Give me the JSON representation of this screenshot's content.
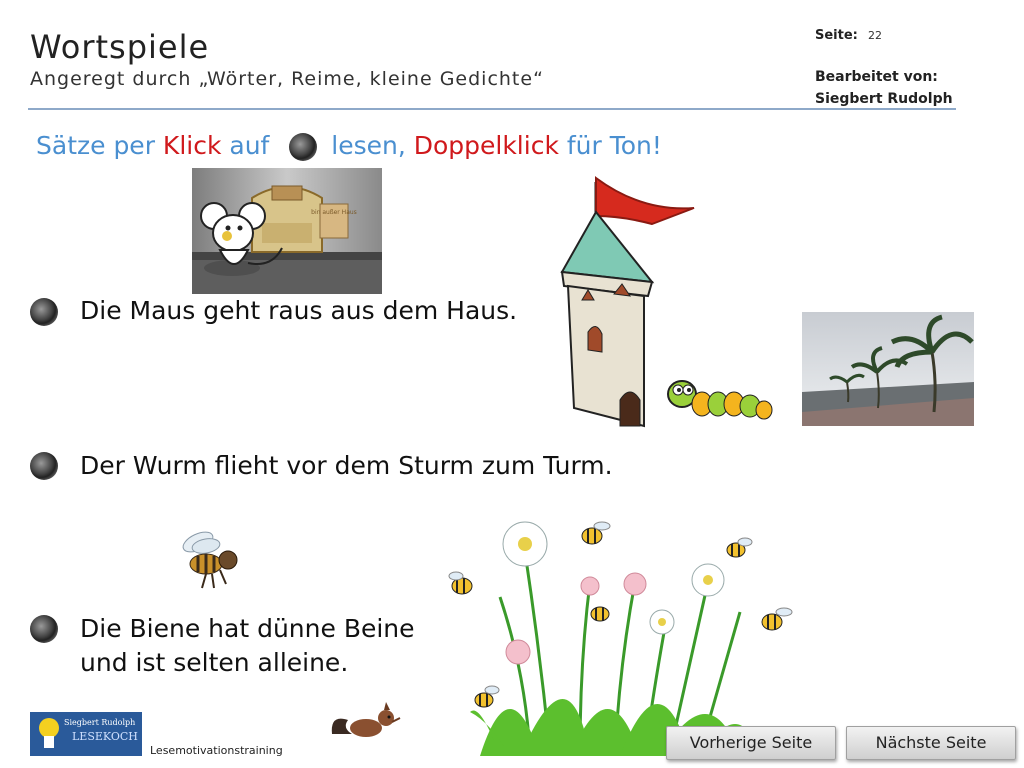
{
  "header": {
    "title": "Wortspiele",
    "subtitle": "Angeregt durch „Wörter, Reime, kleine Gedichte“",
    "page_label": "Seite:",
    "page_number": "22",
    "editor_label": "Bearbeitet  von:",
    "editor_name": "Siegbert  Rudolph"
  },
  "instruction": {
    "part1": "Sätze per ",
    "klick": "Klick",
    "part2": " auf ",
    "part3": " lesen, ",
    "doppelklick": "Doppelklick",
    "part4": " für Ton!"
  },
  "sentences": [
    {
      "line1": "Die Maus geht raus aus dem Haus."
    },
    {
      "line1": "Der Wurm flieht vor dem Sturm zum Turm."
    },
    {
      "line1": "Die Biene hat dünne Beine",
      "line2": "und ist selten alleine."
    }
  ],
  "images": {
    "house_sign": "bin außer Haus"
  },
  "footer": {
    "logo_line1": "Siegbert Rudolph",
    "logo_line2": "LESEKOCH",
    "program": "Lesemotivationstraining",
    "prev_button": "Vorherige Seite",
    "next_button": "Nächste Seite"
  },
  "colors": {
    "instruction_blue": "#4a8fd0",
    "instruction_red": "#d0191c",
    "rule": "#8ea9c9"
  }
}
